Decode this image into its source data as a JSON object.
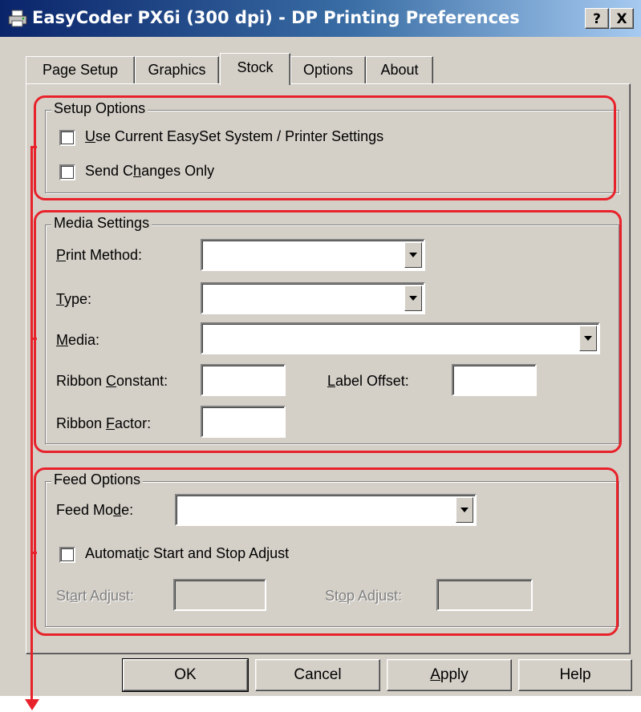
{
  "window": {
    "title": "EasyCoder PX6i (300 dpi) - DP Printing Preferences",
    "help_button": "?",
    "close_button": "X"
  },
  "tabs": [
    "Page Setup",
    "Graphics",
    "Stock",
    "Options",
    "About"
  ],
  "active_tab": "Stock",
  "setup_options": {
    "legend": "Setup Options",
    "use_current_pre": "U",
    "use_current_rest": "se Current EasySet System / Printer Settings",
    "use_current_checked": false,
    "send_changes_pre": "Send C",
    "send_changes_u": "h",
    "send_changes_rest": "anges Only",
    "send_changes_checked": false
  },
  "media_settings": {
    "legend": "Media Settings",
    "print_method_u": "P",
    "print_method_rest": "rint Method:",
    "print_method_value": "",
    "type_u": "T",
    "type_rest": "ype:",
    "type_value": "",
    "media_u": "M",
    "media_rest": "edia:",
    "media_value": "",
    "ribbon_constant_pre": "Ribbon ",
    "ribbon_constant_u": "C",
    "ribbon_constant_rest": "onstant:",
    "ribbon_constant_value": "",
    "label_offset_u": "L",
    "label_offset_rest": "abel Offset:",
    "label_offset_value": "",
    "ribbon_factor_pre": "Ribbon ",
    "ribbon_factor_u": "F",
    "ribbon_factor_rest": "actor:",
    "ribbon_factor_value": ""
  },
  "feed_options": {
    "legend": "Feed Options",
    "feed_mode_pre": "Feed Mo",
    "feed_mode_u": "d",
    "feed_mode_rest": "e:",
    "feed_mode_value": "",
    "auto_adjust_pre": "Automat",
    "auto_adjust_u": "i",
    "auto_adjust_rest": "c Start and Stop Adjust",
    "auto_adjust_checked": false,
    "start_adjust_pre": "St",
    "start_adjust_u": "a",
    "start_adjust_rest": "rt Adjust:",
    "start_adjust_value": "",
    "stop_adjust_pre": "St",
    "stop_adjust_u": "o",
    "stop_adjust_rest": "p Adjust:",
    "stop_adjust_value": ""
  },
  "buttons": {
    "ok": "OK",
    "cancel": "Cancel",
    "apply_u": "A",
    "apply_rest": "pply",
    "help": "Help"
  },
  "annotation_color": "#e8222b"
}
